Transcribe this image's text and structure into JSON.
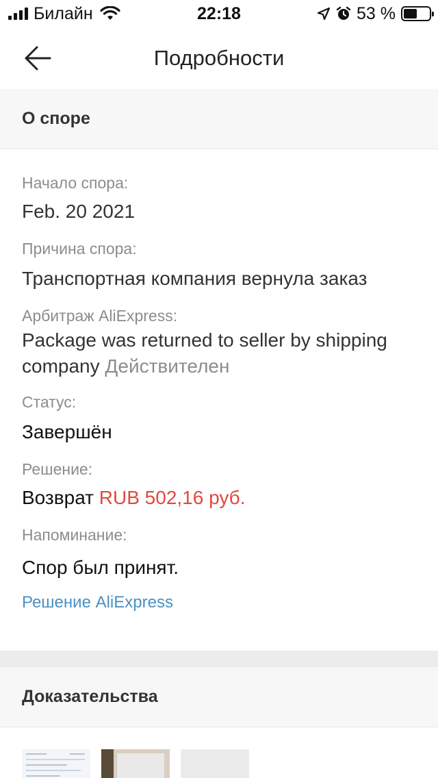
{
  "status_bar": {
    "carrier": "Билайн",
    "time": "22:18",
    "battery_percent": "53 %",
    "battery_level": 0.53
  },
  "nav": {
    "title": "Подробности",
    "back_icon": "arrow-left-icon"
  },
  "dispute": {
    "section_title": "О споре",
    "start_label": "Начало спора:",
    "start_value": "Feb. 20 2021",
    "reason_label": "Причина спора:",
    "reason_value": "Транспортная компания вернула заказ",
    "arbitration_label": "Арбитраж AliExpress:",
    "arbitration_value": "Package was returned to seller by shipping company",
    "arbitration_status": "Действителен",
    "status_label": "Статус:",
    "status_value": "Завершён",
    "decision_label": "Решение:",
    "decision_prefix": "Возврат",
    "decision_amount": "RUB 502,16 руб.",
    "reminder_label": "Напоминание:",
    "reminder_value": "Спор был принят.",
    "link_label": "Решение AliExpress",
    "accent_color": "#e04a3c",
    "link_color": "#4a90c2"
  },
  "evidence": {
    "section_title": "Доказательства",
    "thumbnails_count": 3
  }
}
